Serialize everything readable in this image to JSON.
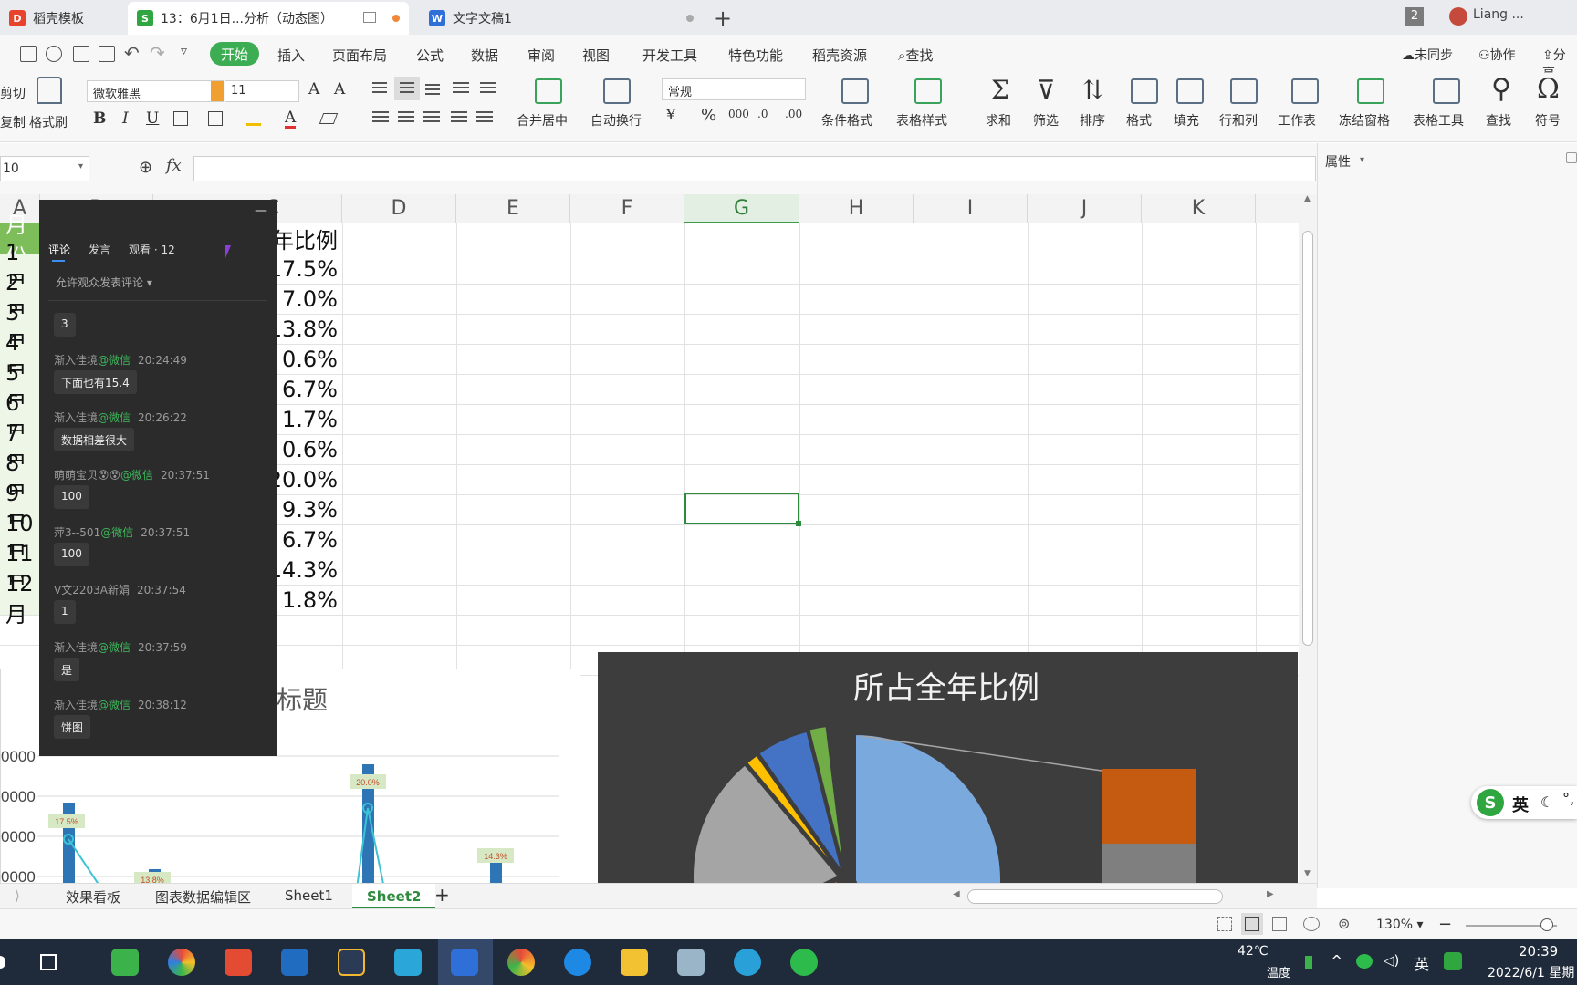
{
  "titlebar": {
    "tabs": [
      {
        "label": "稻壳模板",
        "icon": "docer-icon",
        "color": "#e8432d"
      },
      {
        "label": "13：6月1日...分析（动态图）",
        "icon": "spreadsheet-icon",
        "color": "#2fa640"
      },
      {
        "label": "文字文稿1",
        "icon": "writer-icon",
        "color": "#2f6fd8"
      }
    ],
    "window_count": "2",
    "user": "Liang ..."
  },
  "menubar": {
    "start": "开始",
    "items": [
      "插入",
      "页面布局",
      "公式",
      "数据",
      "审阅",
      "视图",
      "开发工具",
      "特色功能",
      "稻壳资源"
    ],
    "search": "查找",
    "right": [
      "未同步",
      "协作",
      "分享"
    ]
  },
  "ribbon": {
    "clipboard": {
      "cut": "剪切",
      "copy": "复制",
      "format_painter": "格式刷"
    },
    "font": {
      "name": "微软雅黑",
      "size": "11"
    },
    "merge_center": "合并居中",
    "wrap_text": "自动换行",
    "number_format": "常规",
    "buttons": [
      "条件格式",
      "表格样式",
      "求和",
      "筛选",
      "排序",
      "格式",
      "填充",
      "行和列",
      "工作表",
      "冻结窗格",
      "表格工具",
      "查找",
      "符号"
    ]
  },
  "formulabar": {
    "name_box": "10",
    "fx": "fx",
    "value": ""
  },
  "taskpane": {
    "title": "属性"
  },
  "sheet": {
    "columns": [
      "A",
      "B",
      "C",
      "D",
      "E",
      "F",
      "G",
      "H",
      "I",
      "J",
      "K"
    ],
    "selected_column": "G",
    "header_a": "月份",
    "header_c": "年比例",
    "rows": [
      {
        "month": "1月",
        "ratio": "17.5%"
      },
      {
        "month": "2月",
        "ratio": "7.0%"
      },
      {
        "month": "3月",
        "ratio": "13.8%"
      },
      {
        "month": "4月",
        "ratio": "0.6%"
      },
      {
        "month": "5月",
        "ratio": "6.7%"
      },
      {
        "month": "6月",
        "ratio": "1.7%"
      },
      {
        "month": "7月",
        "ratio": "0.6%"
      },
      {
        "month": "8月",
        "ratio": "20.0%"
      },
      {
        "month": "9月",
        "ratio": "9.3%"
      },
      {
        "month": "10月",
        "ratio": "6.7%"
      },
      {
        "month": "11月",
        "ratio": "14.3%"
      },
      {
        "month": "12月",
        "ratio": "1.8%"
      }
    ]
  },
  "chart_data": [
    {
      "type": "bar",
      "title": "标题",
      "y_tick_labels": [
        "0000",
        "0000",
        "0000",
        "0000"
      ],
      "data_labels": [
        "17.5%",
        "13.8%",
        "20.0%",
        "14.3%"
      ],
      "bar_color": "#2e75b6",
      "line_color": "#3bc4d4"
    },
    {
      "type": "pie",
      "title": "所占全年比例",
      "background": "#3d3d3d",
      "slice_colors": [
        "#7aa9de",
        "#ff8a3c",
        "#a5a5a5",
        "#ffc000",
        "#4472c4",
        "#70ad47"
      ],
      "bar_of_pie_colors": [
        "#c55a11",
        "#7f7f7f"
      ]
    }
  ],
  "comments": {
    "tabs": [
      "评论",
      "发言",
      "观看 · 12"
    ],
    "allow": "允许观众发表评论",
    "entries": [
      {
        "user": "",
        "source": "",
        "time": "",
        "text": "3"
      },
      {
        "user": "渐入佳境",
        "source": "@微信",
        "time": "20:24:49",
        "text": "下面也有15.4"
      },
      {
        "user": "渐入佳境",
        "source": "@微信",
        "time": "20:26:22",
        "text": "数据相差很大"
      },
      {
        "user": "萌萌宝贝😵😵",
        "source": "@微信",
        "time": "20:37:51",
        "text": "100"
      },
      {
        "user": "萍3--501",
        "source": "@微信",
        "time": "20:37:51",
        "text": "100"
      },
      {
        "user": "V文2203A新娟",
        "source": "",
        "time": "20:37:54",
        "text": "1"
      },
      {
        "user": "渐入佳境",
        "source": "@微信",
        "time": "20:37:59",
        "text": "是"
      },
      {
        "user": "渐入佳境",
        "source": "@微信",
        "time": "20:38:12",
        "text": "饼图"
      }
    ]
  },
  "sheet_tabs": {
    "tabs": [
      "效果看板",
      "图表数据编辑区",
      "Sheet1",
      "Sheet2"
    ],
    "active": "Sheet2"
  },
  "statusbar": {
    "zoom": "130%"
  },
  "ime": {
    "label": "英"
  },
  "taskbar": {
    "weather": "42℃",
    "weather_label": "温度",
    "lang": "英",
    "time": "20:39",
    "date": "2022/6/1 星期"
  }
}
